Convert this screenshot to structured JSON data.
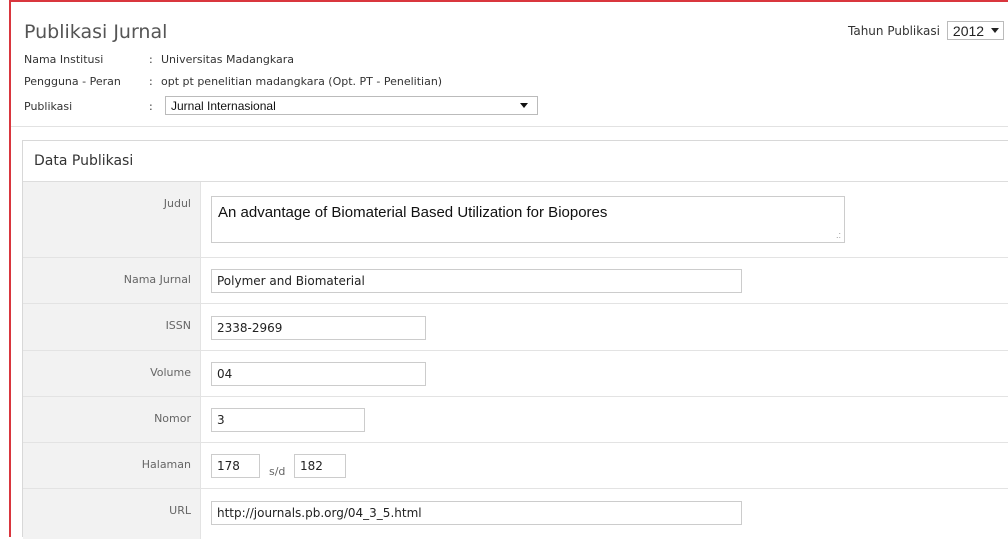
{
  "header": {
    "title": "Publikasi Jurnal",
    "year_label": "Tahun Publikasi",
    "year_value": "2012"
  },
  "info": {
    "institusi_label": "Nama Institusi",
    "institusi_value": "Universitas Madangkara",
    "pengguna_label": "Pengguna - Peran",
    "pengguna_value": "opt pt penelitian madangkara (Opt. PT - Penelitian)",
    "publikasi_label": "Publikasi",
    "publikasi_value": "Jurnal Internasional",
    "colon": ":"
  },
  "panel": {
    "heading": "Data Publikasi",
    "judul_label": "Judul",
    "judul_value": "An advantage of Biomaterial Based Utilization for Biopores",
    "nama_jurnal_label": "Nama Jurnal",
    "nama_jurnal_value": "Polymer and Biomaterial",
    "issn_label": "ISSN",
    "issn_value": "2338-2969",
    "volume_label": "Volume",
    "volume_value": "04",
    "nomor_label": "Nomor",
    "nomor_value": "3",
    "halaman_label": "Halaman",
    "halaman_from": "178",
    "halaman_sd": "s/d",
    "halaman_to": "182",
    "url_label": "URL",
    "url_value": "http://journals.pb.org/04_3_5.html"
  },
  "colors": {
    "frame": "#d9363e",
    "label_bg": "#f2f2f2"
  }
}
